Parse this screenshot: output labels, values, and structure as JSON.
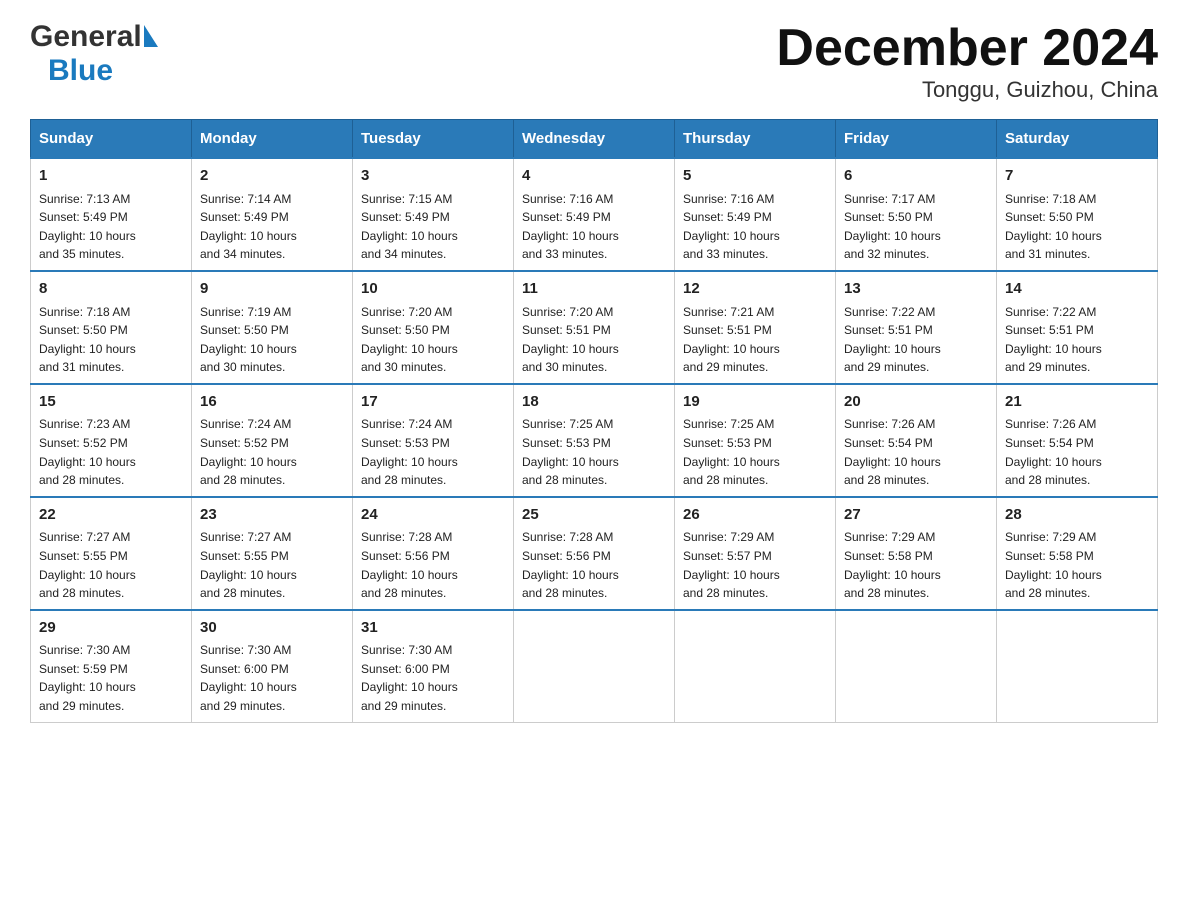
{
  "header": {
    "logo_general": "General",
    "logo_blue": "Blue",
    "title": "December 2024",
    "subtitle": "Tonggu, Guizhou, China"
  },
  "days_of_week": [
    "Sunday",
    "Monday",
    "Tuesday",
    "Wednesday",
    "Thursday",
    "Friday",
    "Saturday"
  ],
  "weeks": [
    [
      {
        "day": "1",
        "sunrise": "7:13 AM",
        "sunset": "5:49 PM",
        "daylight": "10 hours and 35 minutes."
      },
      {
        "day": "2",
        "sunrise": "7:14 AM",
        "sunset": "5:49 PM",
        "daylight": "10 hours and 34 minutes."
      },
      {
        "day": "3",
        "sunrise": "7:15 AM",
        "sunset": "5:49 PM",
        "daylight": "10 hours and 34 minutes."
      },
      {
        "day": "4",
        "sunrise": "7:16 AM",
        "sunset": "5:49 PM",
        "daylight": "10 hours and 33 minutes."
      },
      {
        "day": "5",
        "sunrise": "7:16 AM",
        "sunset": "5:49 PM",
        "daylight": "10 hours and 33 minutes."
      },
      {
        "day": "6",
        "sunrise": "7:17 AM",
        "sunset": "5:50 PM",
        "daylight": "10 hours and 32 minutes."
      },
      {
        "day": "7",
        "sunrise": "7:18 AM",
        "sunset": "5:50 PM",
        "daylight": "10 hours and 31 minutes."
      }
    ],
    [
      {
        "day": "8",
        "sunrise": "7:18 AM",
        "sunset": "5:50 PM",
        "daylight": "10 hours and 31 minutes."
      },
      {
        "day": "9",
        "sunrise": "7:19 AM",
        "sunset": "5:50 PM",
        "daylight": "10 hours and 30 minutes."
      },
      {
        "day": "10",
        "sunrise": "7:20 AM",
        "sunset": "5:50 PM",
        "daylight": "10 hours and 30 minutes."
      },
      {
        "day": "11",
        "sunrise": "7:20 AM",
        "sunset": "5:51 PM",
        "daylight": "10 hours and 30 minutes."
      },
      {
        "day": "12",
        "sunrise": "7:21 AM",
        "sunset": "5:51 PM",
        "daylight": "10 hours and 29 minutes."
      },
      {
        "day": "13",
        "sunrise": "7:22 AM",
        "sunset": "5:51 PM",
        "daylight": "10 hours and 29 minutes."
      },
      {
        "day": "14",
        "sunrise": "7:22 AM",
        "sunset": "5:51 PM",
        "daylight": "10 hours and 29 minutes."
      }
    ],
    [
      {
        "day": "15",
        "sunrise": "7:23 AM",
        "sunset": "5:52 PM",
        "daylight": "10 hours and 28 minutes."
      },
      {
        "day": "16",
        "sunrise": "7:24 AM",
        "sunset": "5:52 PM",
        "daylight": "10 hours and 28 minutes."
      },
      {
        "day": "17",
        "sunrise": "7:24 AM",
        "sunset": "5:53 PM",
        "daylight": "10 hours and 28 minutes."
      },
      {
        "day": "18",
        "sunrise": "7:25 AM",
        "sunset": "5:53 PM",
        "daylight": "10 hours and 28 minutes."
      },
      {
        "day": "19",
        "sunrise": "7:25 AM",
        "sunset": "5:53 PM",
        "daylight": "10 hours and 28 minutes."
      },
      {
        "day": "20",
        "sunrise": "7:26 AM",
        "sunset": "5:54 PM",
        "daylight": "10 hours and 28 minutes."
      },
      {
        "day": "21",
        "sunrise": "7:26 AM",
        "sunset": "5:54 PM",
        "daylight": "10 hours and 28 minutes."
      }
    ],
    [
      {
        "day": "22",
        "sunrise": "7:27 AM",
        "sunset": "5:55 PM",
        "daylight": "10 hours and 28 minutes."
      },
      {
        "day": "23",
        "sunrise": "7:27 AM",
        "sunset": "5:55 PM",
        "daylight": "10 hours and 28 minutes."
      },
      {
        "day": "24",
        "sunrise": "7:28 AM",
        "sunset": "5:56 PM",
        "daylight": "10 hours and 28 minutes."
      },
      {
        "day": "25",
        "sunrise": "7:28 AM",
        "sunset": "5:56 PM",
        "daylight": "10 hours and 28 minutes."
      },
      {
        "day": "26",
        "sunrise": "7:29 AM",
        "sunset": "5:57 PM",
        "daylight": "10 hours and 28 minutes."
      },
      {
        "day": "27",
        "sunrise": "7:29 AM",
        "sunset": "5:58 PM",
        "daylight": "10 hours and 28 minutes."
      },
      {
        "day": "28",
        "sunrise": "7:29 AM",
        "sunset": "5:58 PM",
        "daylight": "10 hours and 28 minutes."
      }
    ],
    [
      {
        "day": "29",
        "sunrise": "7:30 AM",
        "sunset": "5:59 PM",
        "daylight": "10 hours and 29 minutes."
      },
      {
        "day": "30",
        "sunrise": "7:30 AM",
        "sunset": "6:00 PM",
        "daylight": "10 hours and 29 minutes."
      },
      {
        "day": "31",
        "sunrise": "7:30 AM",
        "sunset": "6:00 PM",
        "daylight": "10 hours and 29 minutes."
      },
      null,
      null,
      null,
      null
    ]
  ],
  "labels": {
    "sunrise": "Sunrise:",
    "sunset": "Sunset:",
    "daylight": "Daylight:"
  }
}
